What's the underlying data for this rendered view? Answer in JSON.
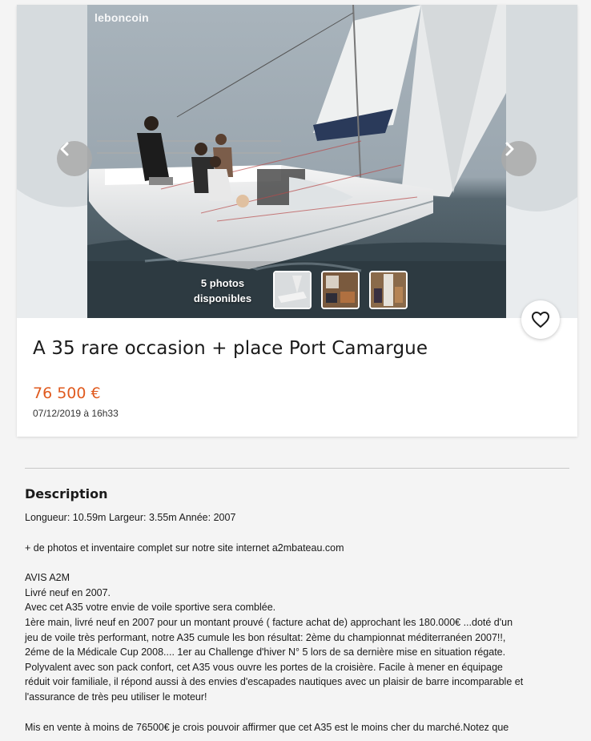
{
  "gallery": {
    "watermark": "leboncoin",
    "photos_count_line1": "5 photos",
    "photos_count_line2": "disponibles"
  },
  "listing": {
    "title": "A 35 rare occasion + place Port Camargue",
    "price": "76 500 €",
    "date": "07/12/2019 à 16h33"
  },
  "description": {
    "heading": "Description",
    "lines": [
      "Longueur: 10.59m Largeur: 3.55m Année: 2007",
      "",
      "+ de photos et inventaire complet sur notre site internet a2mbateau.com",
      "",
      "AVIS A2M",
      "Livré neuf en 2007.",
      "Avec cet A35 votre envie de voile sportive sera comblée.",
      "1ère main, livré neuf en 2007 pour un montant prouvé ( facture achat de) approchant les 180.000€ ...doté d'un",
      "jeu de voile très performant, notre A35 cumule les bon résultat: 2ème du championnat méditerranéen 2007!!,",
      "2éme de la Médicale Cup 2008.... 1er au Challenge d'hiver N° 5 lors de sa dernière mise en situation régate.",
      "Polyvalent avec son pack confort, cet A35 vous ouvre les portes de la croisière. Facile à mener en équipage",
      "réduit voir familiale, il répond aussi à des envies d'escapades nautiques avec un plaisir de barre incomparable et",
      "l'assurance de très peu utiliser le moteur!",
      "",
      "Mis en vente à moins de 76500€ je crois pouvoir affirmer que cet A35 est le moins cher du marché.Notez que"
    ]
  },
  "colors": {
    "price": "#e05a1e",
    "background": "#f4f4f4"
  },
  "icons": {
    "prev": "chevron-left-icon",
    "next": "chevron-right-icon",
    "favorite": "heart-icon"
  }
}
